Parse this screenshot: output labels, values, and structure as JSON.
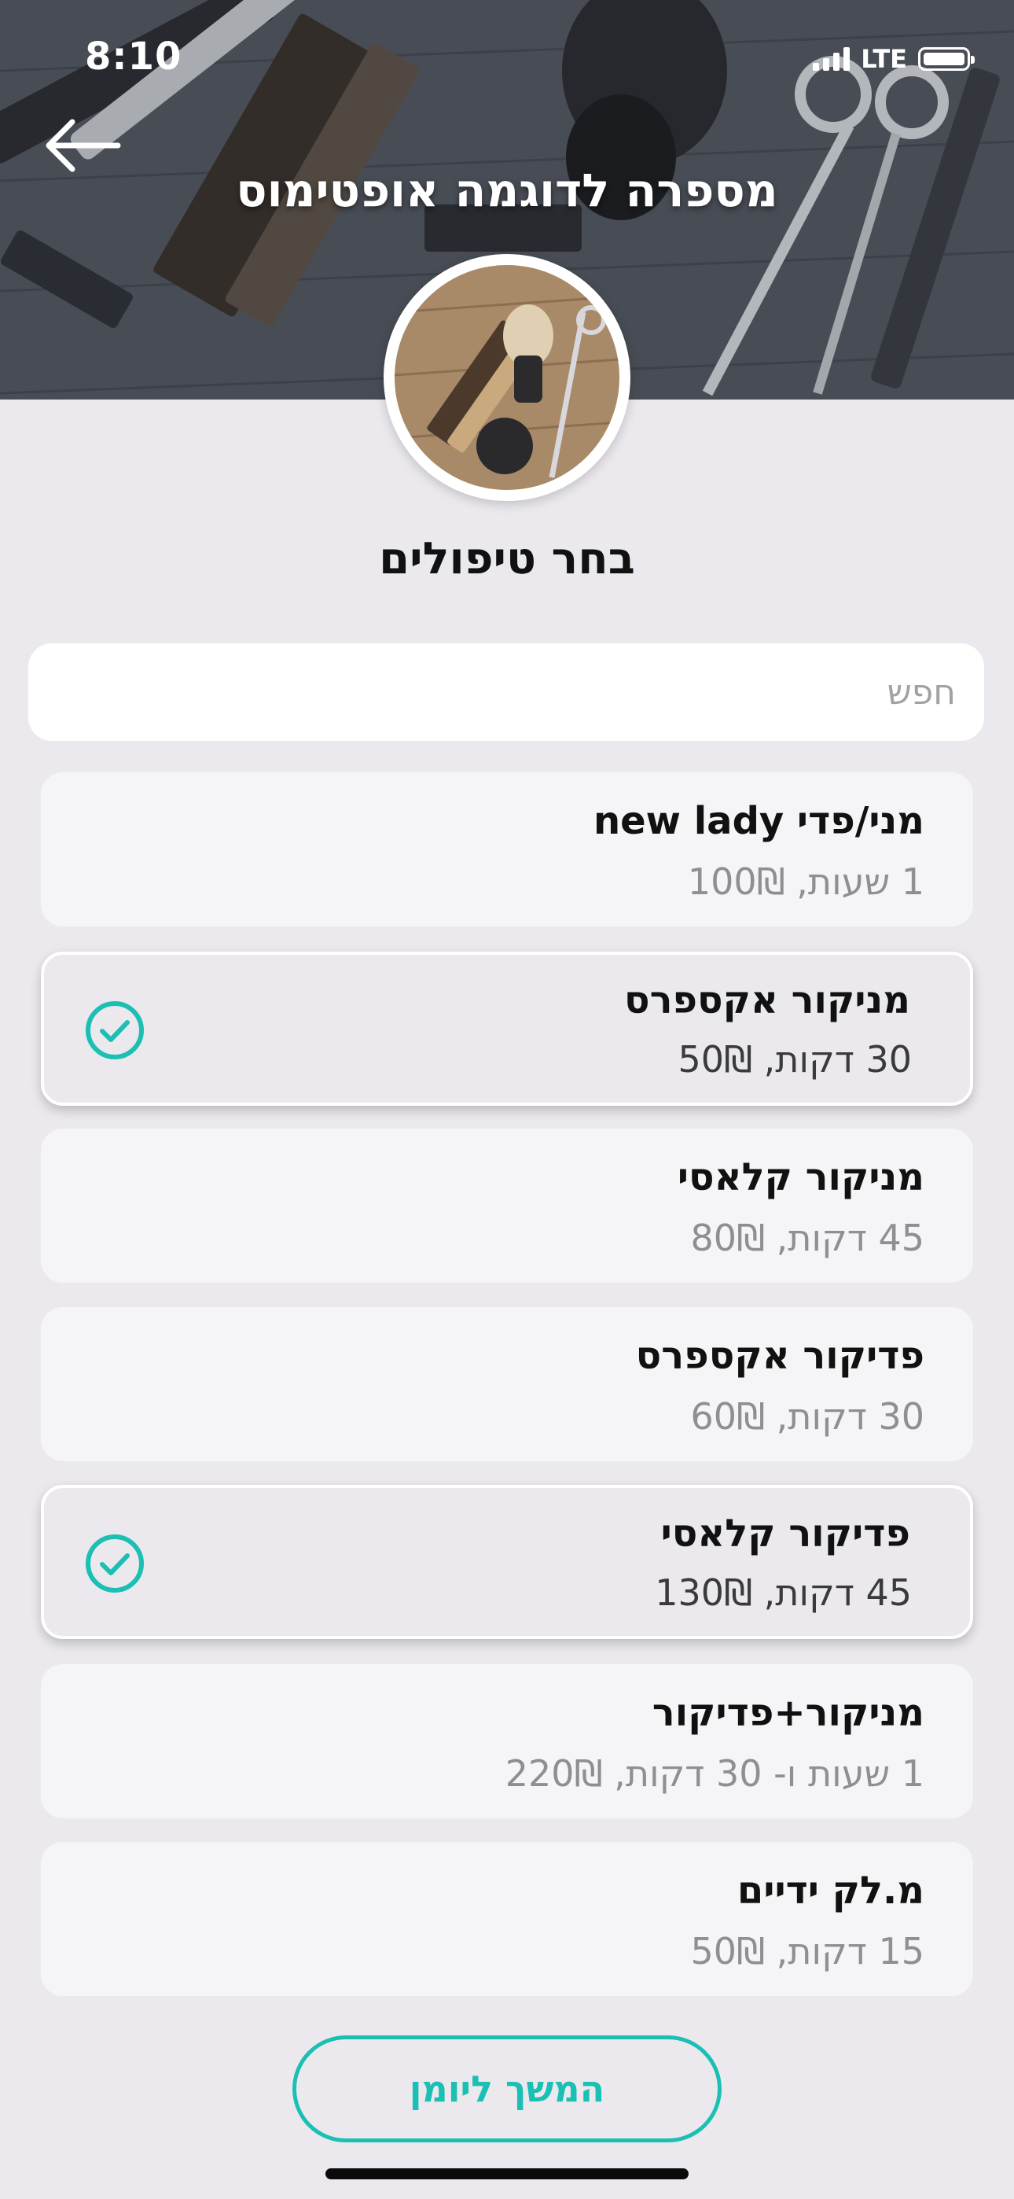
{
  "status_bar": {
    "time": "8:10",
    "network": "LTE"
  },
  "header": {
    "title": "מספרה לדוגמה אופטימוס"
  },
  "section_title": "בחר טיפולים",
  "search": {
    "placeholder": "חפש",
    "value": ""
  },
  "services": [
    {
      "name": "מני/פדי new lady",
      "meta": "1 שעות, 100₪",
      "selected": false
    },
    {
      "name": "מניקור אקספרס",
      "meta": "30 דקות, 50₪",
      "selected": true
    },
    {
      "name": "מניקור קלאסי",
      "meta": "45 דקות, 80₪",
      "selected": false
    },
    {
      "name": "פדיקור אקספרס",
      "meta": "30 דקות, 60₪",
      "selected": false
    },
    {
      "name": "פדיקור קלאסי",
      "meta": "45 דקות, 130₪",
      "selected": true
    },
    {
      "name": "מניקור+פדיקור",
      "meta": "1 שעות ו- 30 דקות, 220₪",
      "selected": false
    },
    {
      "name": "מ.לק ידיים",
      "meta": "15 דקות, 50₪",
      "selected": false
    }
  ],
  "continue_label": "המשך ליומן",
  "colors": {
    "accent": "#1bbfb3",
    "background": "#ebe9ed",
    "card": "#f5f5f7"
  }
}
